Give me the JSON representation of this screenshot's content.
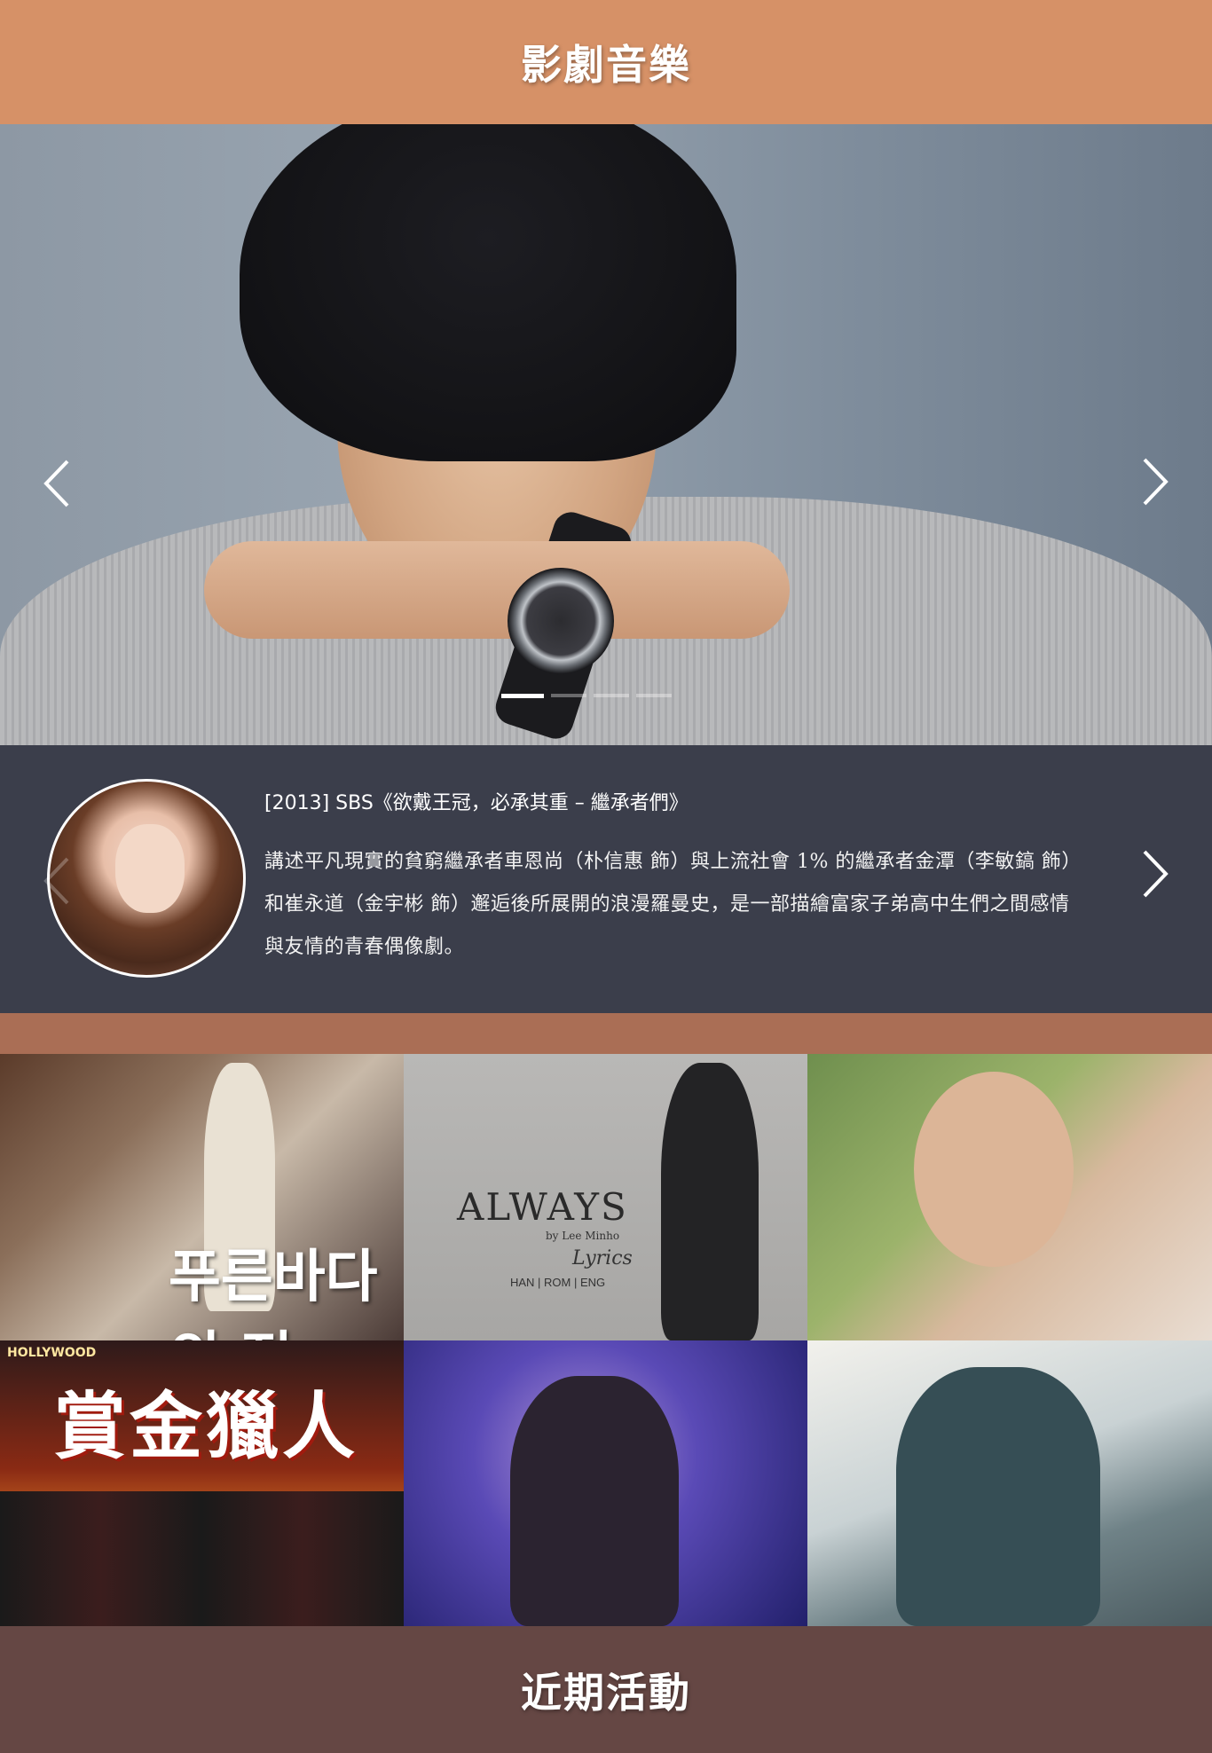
{
  "header": {
    "title": "影劇音樂"
  },
  "hero": {
    "prev_icon": "chevron-left-icon",
    "next_icon": "chevron-right-icon",
    "slide_count": 4,
    "active_slide": 1
  },
  "info": {
    "title": "[2013] SBS《欲戴王冠，必承其重 – 繼承者們》",
    "desc_line1": "講述平凡現實的貧窮繼承者車恩尚（朴信惠 飾）與上流社會 1% 的繼承者金潭（李敏鎬 飾）",
    "desc_line2": "和崔永道（金宇彬 飾）邂逅後所展開的浪漫羅曼史，是一部描繪富家子弟高中生們之間感情",
    "desc_line3": "與友情的青春偶像劇。"
  },
  "gallery": {
    "tile1_caption": "푸른바다의 전",
    "tile2_title": "ALWAYS",
    "tile2_by": "by Lee Minho",
    "tile2_lyrics": "Lyrics",
    "tile2_langs": "HAN | ROM | ENG",
    "tile4_top": "HOLLYWOOD",
    "tile4_caption": "賞金獵人"
  },
  "footer": {
    "title": "近期活動"
  },
  "colors": {
    "header_bg": "#d69167",
    "panel_bg": "#3b3e4b",
    "strip_bg": "#aa6e55",
    "footer_bg": "#654744"
  }
}
